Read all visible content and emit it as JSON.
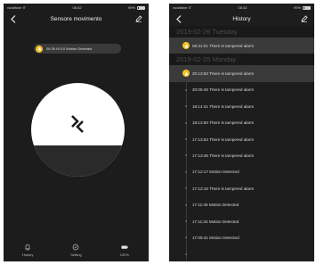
{
  "left": {
    "status": {
      "carrier": "vodafone IT",
      "time": "08:32",
      "battery": "99%"
    },
    "title": "Sensore movimento",
    "notice": "06:35 00:10 Motion Detected",
    "tabs": [
      {
        "label": "History",
        "icon": "bell-icon"
      },
      {
        "label": "Setting",
        "icon": "gear-icon"
      },
      {
        "label": "100%",
        "icon": "battery-icon"
      }
    ]
  },
  "right": {
    "status": {
      "carrier": "vodafone IT",
      "time": "08:32",
      "battery": "99%"
    },
    "title": "History",
    "groups": [
      {
        "date": "2019-02-26 Tuesday",
        "items": [
          {
            "time": "06:31:01",
            "text": "There is tampered alarm",
            "highlight": true
          }
        ]
      },
      {
        "date": "2019-02-25 Monday",
        "items": [
          {
            "time": "20:13:50",
            "text": "There is tampered alarm",
            "highlight": true
          },
          {
            "time": "20:05:45",
            "text": "There is tampered alarm"
          },
          {
            "time": "18:14:41",
            "text": "There is tampered alarm"
          },
          {
            "time": "18:13:50",
            "text": "There is tampered alarm"
          },
          {
            "time": "17:13:53",
            "text": "There is tampered alarm"
          },
          {
            "time": "17:13:45",
            "text": "There is tampered alarm"
          },
          {
            "time": "17:12:17",
            "text": "Motion Detected"
          },
          {
            "time": "17:12:16",
            "text": "There is tampered alarm"
          },
          {
            "time": "17:11:46",
            "text": "Motion Detected"
          },
          {
            "time": "17:11:34",
            "text": "Motion Detected"
          },
          {
            "time": "17:09:41",
            "text": "Motion Detected"
          }
        ]
      }
    ]
  },
  "colors": {
    "accent": "#f2c322",
    "background": "#1e1e1e",
    "highlight": "#3a3a3a"
  }
}
